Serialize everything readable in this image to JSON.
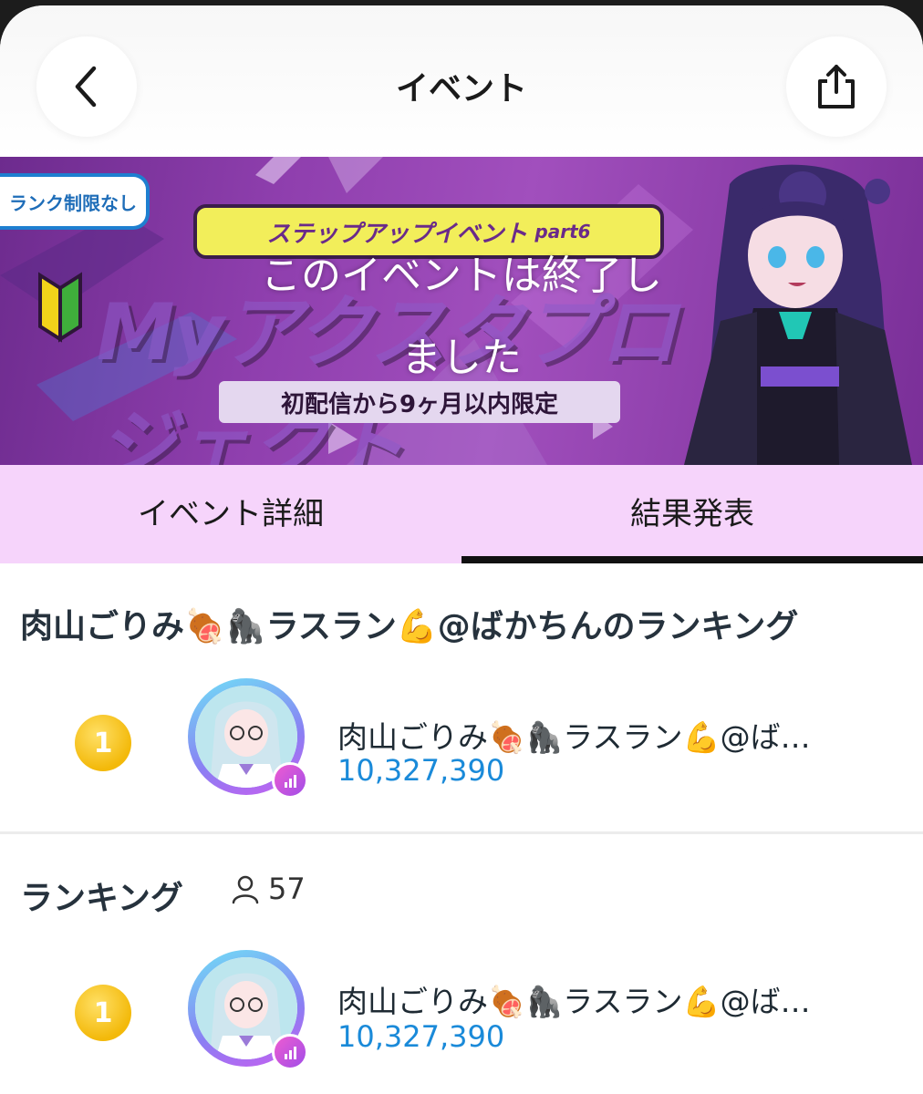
{
  "header": {
    "title": "イベント",
    "back_icon": "chevron-left-icon",
    "share_icon": "share-icon"
  },
  "banner": {
    "rank_badge": "ランク制限なし",
    "event_type": "ステップアップイベント",
    "event_part": "part6",
    "logo_text": "Myアクスタプロジェクト",
    "subtitle": "初配信から9ヶ月以内限定",
    "ended_line1": "このイベントは終了し",
    "ended_line2": "ました"
  },
  "tabs": [
    {
      "label": "イベント詳細",
      "selected": false
    },
    {
      "label": "結果発表",
      "selected": true
    }
  ],
  "streamer_ranking": {
    "title": "肉山ごりみ🍖🦍ラスラン💪@ばかちんのランキング",
    "entries": [
      {
        "rank": "1",
        "name": "肉山ごりみ🍖🦍ラスラン💪@ば…",
        "score": "10,327,390"
      }
    ]
  },
  "ranking": {
    "title": "ランキング",
    "participants": "57",
    "entries": [
      {
        "rank": "1",
        "name": "肉山ごりみ🍖🦍ラスラン💪@ば…",
        "score": "10,327,390"
      }
    ]
  },
  "colors": {
    "tab_background": "#f6d4fb",
    "score": "#1a8ad9",
    "medal_gold": "#f3b90a",
    "banner_purple": "#8f3fae"
  }
}
